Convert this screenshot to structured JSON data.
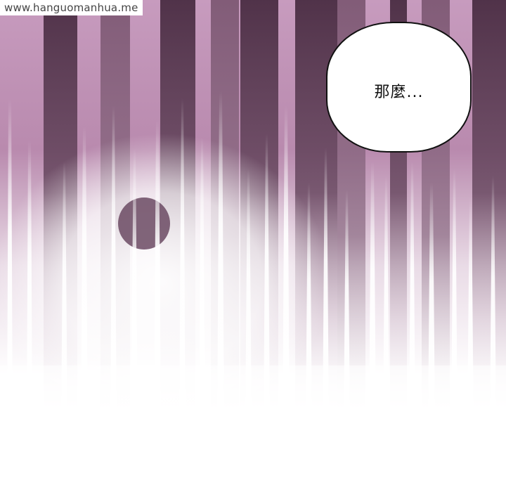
{
  "watermark": {
    "text": "www.hanguomanhua.me"
  },
  "speech_bubble": {
    "text": "那麼..."
  },
  "colors": {
    "background_pink": "#c79bbe",
    "dark_stripe": "#5a3a52",
    "highlight": "#ffffff",
    "bubble_outline": "#111111"
  }
}
